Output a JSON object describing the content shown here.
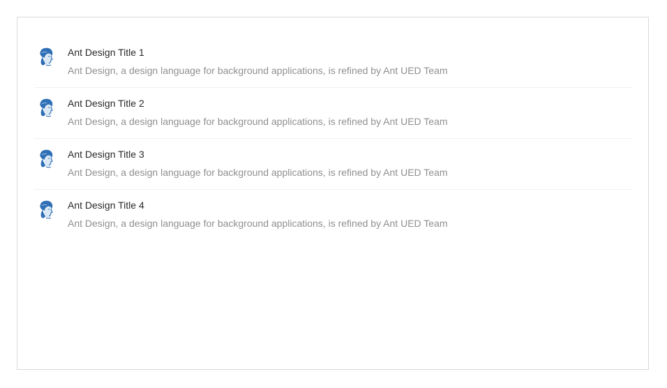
{
  "list": {
    "items": [
      {
        "title": "Ant Design Title 1",
        "description": "Ant Design, a design language for background applications, is refined by Ant UED Team",
        "avatar_icon": "user-avatar-icon"
      },
      {
        "title": "Ant Design Title 2",
        "description": "Ant Design, a design language for background applications, is refined by Ant UED Team",
        "avatar_icon": "user-avatar-icon"
      },
      {
        "title": "Ant Design Title 3",
        "description": "Ant Design, a design language for background applications, is refined by Ant UED Team",
        "avatar_icon": "user-avatar-icon"
      },
      {
        "title": "Ant Design Title 4",
        "description": "Ant Design, a design language for background applications, is refined by Ant UED Team",
        "avatar_icon": "user-avatar-icon"
      }
    ]
  },
  "colors": {
    "avatar_blue": "#2f6fb5",
    "title": "#262626",
    "description": "#8c8c8c",
    "divider": "#f0f0f0",
    "frame_border": "#d9d9d9"
  }
}
